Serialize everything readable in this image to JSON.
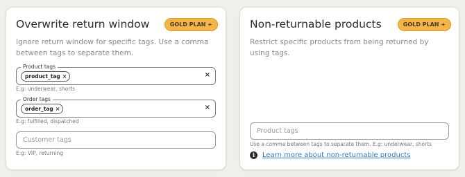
{
  "overwrite_card": {
    "title": "Overwrite return window",
    "badge": "GOLD PLAN +",
    "description": "Ignore return window for specific tags. Use a comma between tags to separate them.",
    "product_tags": {
      "label": "Product tags",
      "chips": [
        "product_tag"
      ],
      "helper": "E.g: underwear, shorts"
    },
    "order_tags": {
      "label": "Order tags",
      "chips": [
        "order_tag"
      ],
      "helper": "E.g: fulfilled, dispatched"
    },
    "customer_tags": {
      "placeholder": "Customer tags",
      "value": "",
      "helper": "E.g: VIP, returning"
    }
  },
  "nonreturnable_card": {
    "title": "Non-returnable products",
    "badge": "GOLD PLAN +",
    "description": "Restrict specific products from being returned by using tags.",
    "product_tags": {
      "placeholder": "Product tags",
      "value": "",
      "helper": "Use a comma between tags to separate them. E.g: underwear, shorts"
    },
    "learn_more": "Learn more about non-returnable products"
  },
  "icons": {
    "chip_remove": "×",
    "clear": "×",
    "info": "i"
  },
  "colors": {
    "badge_bg": "#f3b54a",
    "link": "#2f7fc1",
    "page_bg": "#f1efe9"
  }
}
